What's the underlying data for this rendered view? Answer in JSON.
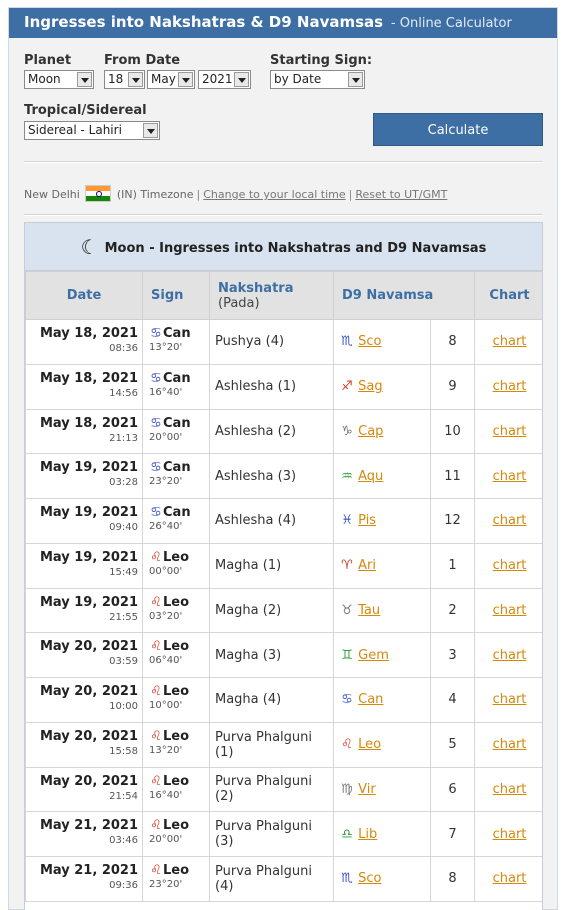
{
  "title": {
    "main": "Ingresses into Nakshatras & D9 Navamsas",
    "sub": "- Online Calculator"
  },
  "form": {
    "planet_label": "Planet",
    "planet_value": "Moon",
    "from_date_label": "From Date",
    "day_value": "18",
    "month_value": "May",
    "year_value": "2021",
    "starting_sign_label": "Starting Sign:",
    "starting_sign_value": "by Date",
    "zodiac_label": "Tropical/Sidereal",
    "zodiac_value": "Sidereal - Lahiri",
    "calculate_label": "Calculate"
  },
  "timezone": {
    "city": "New Delhi",
    "country_code": "(IN) Timezone",
    "change_link": "Change to your local time",
    "reset_link": "Reset to UT/GMT",
    "separator": "|"
  },
  "results": {
    "heading": "Moon - Ingresses into Nakshatras and D9 Navamsas",
    "moon_icon": "☾",
    "columns": {
      "date": "Date",
      "sign": "Sign",
      "nakshatra": "Nakshatra",
      "pada": "(Pada)",
      "navamsa": "D9 Navamsa",
      "chart": "Chart"
    },
    "rows": [
      {
        "date": "May 18, 2021",
        "time": "08:36",
        "sign_glyph": "♋",
        "sign": "Can",
        "deg": "13°20'",
        "nak": "Pushya (4)",
        "nav_glyph": "♏",
        "nav": "Sco",
        "nav_color": "#3a4fc8",
        "num": "8",
        "chart": "chart"
      },
      {
        "date": "May 18, 2021",
        "time": "14:56",
        "sign_glyph": "♋",
        "sign": "Can",
        "deg": "16°40'",
        "nak": "Ashlesha (1)",
        "nav_glyph": "♐",
        "nav": "Sag",
        "nav_color": "#d23b2a",
        "num": "9",
        "chart": "chart"
      },
      {
        "date": "May 18, 2021",
        "time": "21:13",
        "sign_glyph": "♋",
        "sign": "Can",
        "deg": "20°00'",
        "nak": "Ashlesha (2)",
        "nav_glyph": "♑",
        "nav": "Cap",
        "nav_color": "#777777",
        "num": "10",
        "chart": "chart"
      },
      {
        "date": "May 19, 2021",
        "time": "03:28",
        "sign_glyph": "♋",
        "sign": "Can",
        "deg": "23°20'",
        "nak": "Ashlesha (3)",
        "nav_glyph": "♒",
        "nav": "Aqu",
        "nav_color": "#2f9a3a",
        "num": "11",
        "chart": "chart"
      },
      {
        "date": "May 19, 2021",
        "time": "09:40",
        "sign_glyph": "♋",
        "sign": "Can",
        "deg": "26°40'",
        "nak": "Ashlesha (4)",
        "nav_glyph": "♓",
        "nav": "Pis",
        "nav_color": "#3a4fc8",
        "num": "12",
        "chart": "chart"
      },
      {
        "date": "May 19, 2021",
        "time": "15:49",
        "sign_glyph": "♌",
        "sign": "Leo",
        "deg": "00°00'",
        "nak": "Magha (1)",
        "nav_glyph": "♈",
        "nav": "Ari",
        "nav_color": "#d23b2a",
        "num": "1",
        "chart": "chart"
      },
      {
        "date": "May 19, 2021",
        "time": "21:55",
        "sign_glyph": "♌",
        "sign": "Leo",
        "deg": "03°20'",
        "nak": "Magha (2)",
        "nav_glyph": "♉",
        "nav": "Tau",
        "nav_color": "#777777",
        "num": "2",
        "chart": "chart"
      },
      {
        "date": "May 20, 2021",
        "time": "03:59",
        "sign_glyph": "♌",
        "sign": "Leo",
        "deg": "06°40'",
        "nak": "Magha (3)",
        "nav_glyph": "♊",
        "nav": "Gem",
        "nav_color": "#2f9a3a",
        "num": "3",
        "chart": "chart"
      },
      {
        "date": "May 20, 2021",
        "time": "10:00",
        "sign_glyph": "♌",
        "sign": "Leo",
        "deg": "10°00'",
        "nak": "Magha (4)",
        "nav_glyph": "♋",
        "nav": "Can",
        "nav_color": "#3a4fc8",
        "num": "4",
        "chart": "chart"
      },
      {
        "date": "May 20, 2021",
        "time": "15:58",
        "sign_glyph": "♌",
        "sign": "Leo",
        "deg": "13°20'",
        "nak": "Purva Phalguni (1)",
        "nav_glyph": "♌",
        "nav": "Leo",
        "nav_color": "#d23b2a",
        "num": "5",
        "chart": "chart"
      },
      {
        "date": "May 20, 2021",
        "time": "21:54",
        "sign_glyph": "♌",
        "sign": "Leo",
        "deg": "16°40'",
        "nak": "Purva Phalguni (2)",
        "nav_glyph": "♍",
        "nav": "Vir",
        "nav_color": "#777777",
        "num": "6",
        "chart": "chart"
      },
      {
        "date": "May 21, 2021",
        "time": "03:46",
        "sign_glyph": "♌",
        "sign": "Leo",
        "deg": "20°00'",
        "nak": "Purva Phalguni (3)",
        "nav_glyph": "♎",
        "nav": "Lib",
        "nav_color": "#2f9a3a",
        "num": "7",
        "chart": "chart"
      },
      {
        "date": "May 21, 2021",
        "time": "09:36",
        "sign_glyph": "♌",
        "sign": "Leo",
        "deg": "23°20'",
        "nak": "Purva Phalguni (4)",
        "nav_glyph": "♏",
        "nav": "Sco",
        "nav_color": "#3a4fc8",
        "num": "8",
        "chart": "chart"
      }
    ]
  },
  "colors": {
    "accent": "#3d6fa5",
    "link": "#d4880c",
    "fire": "#d23b2a",
    "earth": "#777777",
    "air": "#2f9a3a",
    "water": "#3a4fc8"
  }
}
